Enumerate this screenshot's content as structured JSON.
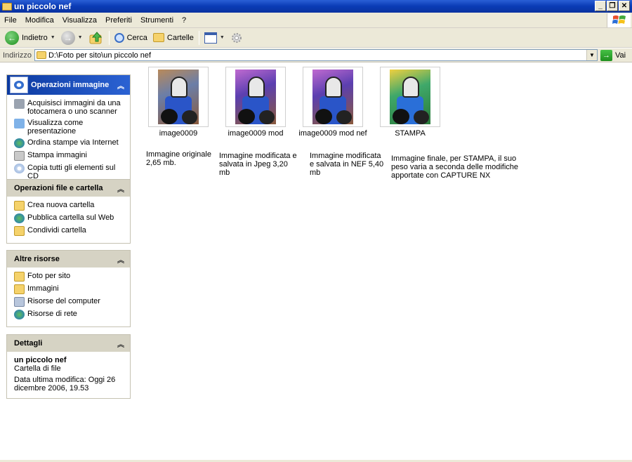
{
  "window": {
    "title": "un piccolo nef"
  },
  "menu": [
    "File",
    "Modifica",
    "Visualizza",
    "Preferiti",
    "Strumenti",
    "?"
  ],
  "toolbar": {
    "back_label": "Indietro",
    "search_label": "Cerca",
    "folders_label": "Cartelle"
  },
  "address": {
    "label": "Indirizzo",
    "value": "D:\\Foto per sito\\un piccolo nef",
    "go_label": "Vai"
  },
  "panels": {
    "image_tasks": {
      "title": "Operazioni immagine",
      "items": [
        "Acquisisci immagini da una fotocamera o uno scanner",
        "Visualizza come presentazione",
        "Ordina stampe via Internet",
        "Stampa immagini",
        "Copia tutti gli elementi sul CD"
      ]
    },
    "file_tasks": {
      "title": "Operazioni file e cartella",
      "items": [
        "Crea nuova cartella",
        "Pubblica cartella sul Web",
        "Condividi cartella"
      ]
    },
    "other_places": {
      "title": "Altre risorse",
      "items": [
        "Foto per sito",
        "Immagini",
        "Risorse del computer",
        "Risorse di rete"
      ]
    },
    "details": {
      "title": "Dettagli",
      "name": "un piccolo nef",
      "type": "Cartella di file",
      "modified": "Data ultima modifica: Oggi 26 dicembre 2006, 19.53"
    }
  },
  "files": [
    {
      "name": "image0009"
    },
    {
      "name": "image0009 mod"
    },
    {
      "name": "image0009 mod nef"
    },
    {
      "name": "STAMPA"
    }
  ],
  "descriptions": [
    "Immagine originale 2,65 mb.",
    "Immagine modificata e salvata in Jpeg 3,20 mb",
    "Immagine modificata e salvata in NEF 5,40 mb",
    "Immagine finale, per STAMPA, il suo peso varia a seconda delle modifiche apportate con CAPTURE NX"
  ],
  "colors": {
    "title_bar": "#0a3bb5",
    "panel_header": "#d6d3c4",
    "special_header": "#2b62d3"
  }
}
